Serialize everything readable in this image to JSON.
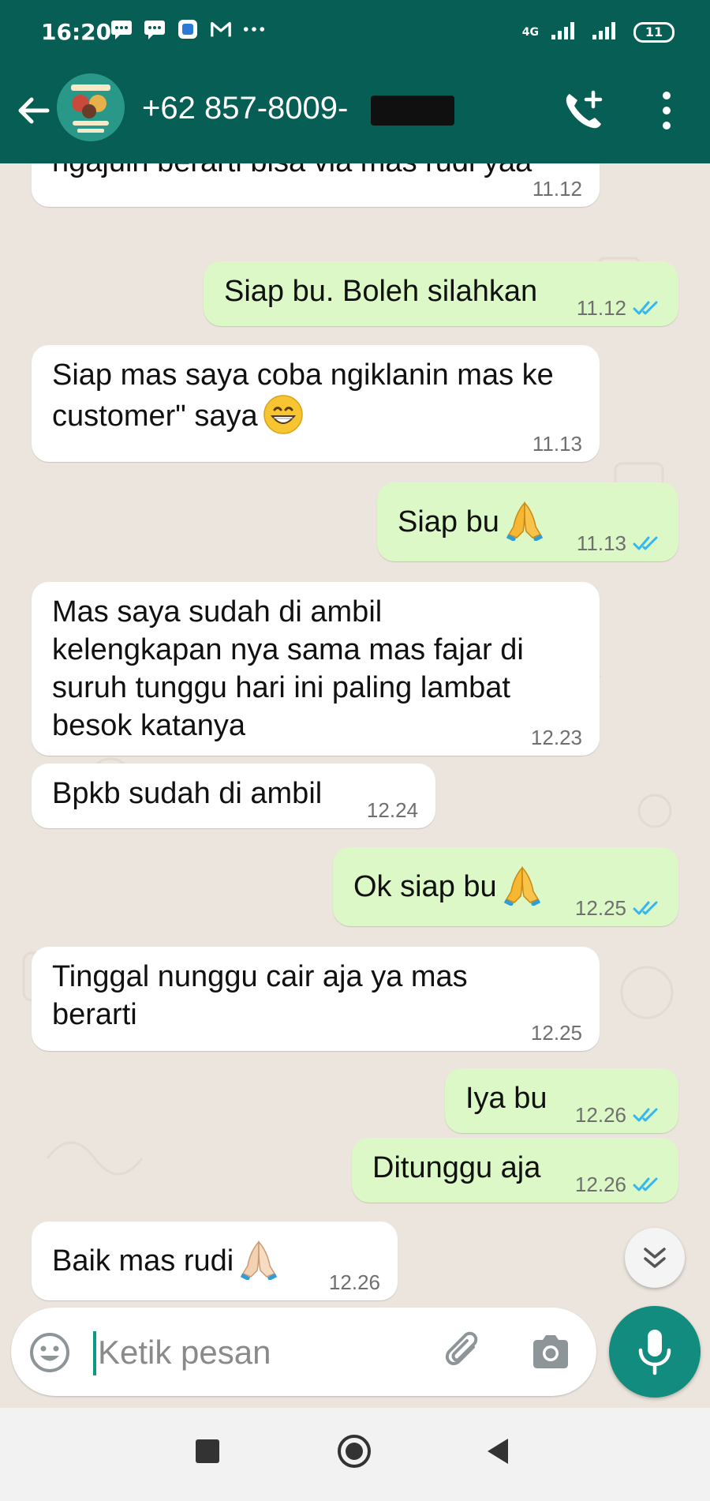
{
  "status_bar": {
    "time": "16:20",
    "network": "4G",
    "battery": "11",
    "notification_icons": [
      "message-icon",
      "message-icon",
      "app-icon",
      "gmail-icon",
      "more-dots-icon"
    ]
  },
  "header": {
    "contact_name": "+62 857-8009-",
    "back_icon": "arrow-left-icon",
    "call_icon": "add-call-icon",
    "menu_icon": "more-vertical-icon"
  },
  "messages": [
    {
      "dir": "in",
      "lines": [
        "ngajuin berarti bisa via mas rudi yaa"
      ],
      "time": "11.12"
    },
    {
      "dir": "out",
      "lines": [
        "Siap bu. Boleh silahkan"
      ],
      "time": "11.12"
    },
    {
      "dir": "in",
      "lines": [
        "Siap mas saya coba ngiklanin mas ke",
        "customer\" saya"
      ],
      "time": "11.13",
      "emoji": "grin"
    },
    {
      "dir": "out",
      "lines": [
        "Siap bu"
      ],
      "time": "11.13",
      "emoji": "pray"
    },
    {
      "dir": "in",
      "lines": [
        "Mas saya sudah di ambil",
        "kelengkapan nya sama mas fajar di",
        "suruh tunggu hari ini paling lambat",
        "besok katanya"
      ],
      "time": "12.23"
    },
    {
      "dir": "in",
      "lines": [
        "Bpkb sudah di ambil"
      ],
      "time": "12.24"
    },
    {
      "dir": "out",
      "lines": [
        "Ok siap bu"
      ],
      "time": "12.25",
      "emoji": "pray"
    },
    {
      "dir": "in",
      "lines": [
        "Tinggal nunggu cair aja ya mas",
        "berarti"
      ],
      "time": "12.25"
    },
    {
      "dir": "out",
      "lines": [
        "Iya bu"
      ],
      "time": "12.26"
    },
    {
      "dir": "out",
      "lines": [
        "Ditunggu aja"
      ],
      "time": "12.26"
    },
    {
      "dir": "in",
      "lines": [
        "Baik mas rudi"
      ],
      "time": "12.26",
      "emoji": "pray-light"
    }
  ],
  "input": {
    "placeholder": "Ketik pesan"
  },
  "colors": {
    "header": "#075e54",
    "out_bubble": "#dcf8c6",
    "in_bubble": "#ffffff",
    "tick": "#34b7f1",
    "mic": "#128c7e"
  }
}
